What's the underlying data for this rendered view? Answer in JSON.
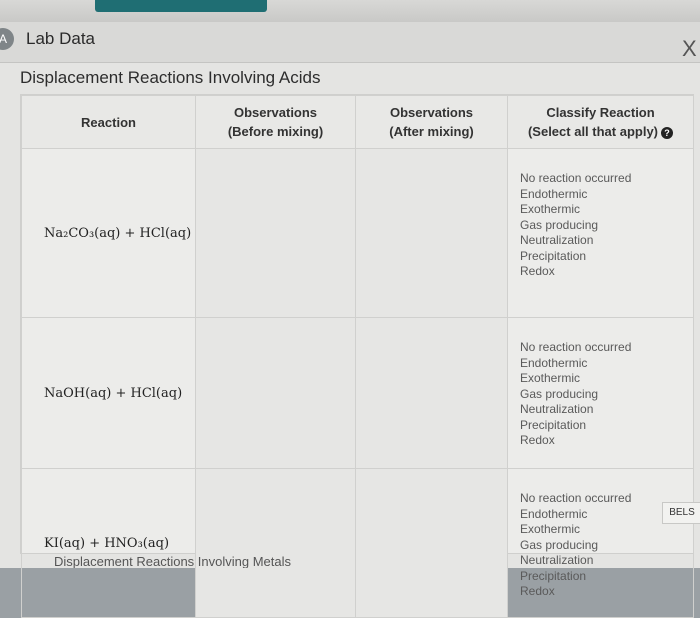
{
  "window": {
    "badge": "A",
    "title": "Lab Data",
    "close_label": "X"
  },
  "section": {
    "title": "Displacement Reactions Involving Acids"
  },
  "table": {
    "headers": [
      {
        "line1": "Reaction",
        "line2": ""
      },
      {
        "line1": "Observations",
        "line2": "(Before mixing)"
      },
      {
        "line1": "Observations",
        "line2": "(After mixing)"
      },
      {
        "line1": "Classify Reaction",
        "line2": "(Select all that apply)"
      }
    ],
    "help_icon": "?",
    "rows": [
      {
        "reaction": "Na₂CO₃(aq) + HCl(aq)",
        "before": "",
        "after": "",
        "options": [
          "No reaction occurred",
          "Endothermic",
          "Exothermic",
          "Gas producing",
          "Neutralization",
          "Precipitation",
          "Redox"
        ]
      },
      {
        "reaction": "NaOH(aq) + HCl(aq)",
        "before": "",
        "after": "",
        "options": [
          "No reaction occurred",
          "Endothermic",
          "Exothermic",
          "Gas producing",
          "Neutralization",
          "Precipitation",
          "Redox"
        ]
      },
      {
        "reaction": "KI(aq) + HNO₃(aq)",
        "before": "",
        "after": "",
        "options": [
          "No reaction occurred",
          "Endothermic",
          "Exothermic",
          "Gas producing",
          "Neutralization",
          "Precipitation",
          "Redox"
        ]
      }
    ]
  },
  "side_tab": {
    "label": "BELS"
  },
  "next_section": {
    "title": "Displacement Reactions Involving Metals"
  }
}
